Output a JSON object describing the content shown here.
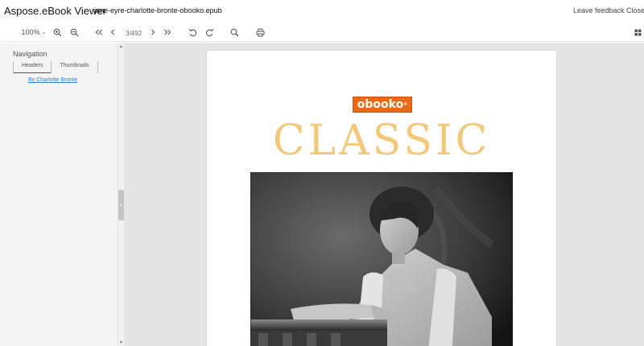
{
  "header": {
    "app_title": "Aspose.eBook Viewer",
    "file_name": "jane-eyre-charlotte-bronte-obooko.epub",
    "leave_feedback": "Leave feedback",
    "close": "Close"
  },
  "toolbar": {
    "zoom_value": "100%",
    "page_indicator": "3/492",
    "icons": [
      "zoom-in-icon",
      "zoom-out-icon",
      "first-page-icon",
      "previous-page-icon",
      "next-page-icon",
      "last-page-icon",
      "rotate-left-icon",
      "rotate-right-icon",
      "search-icon",
      "print-icon",
      "grid-view-icon"
    ]
  },
  "sidebar": {
    "title": "Navigation",
    "tabs": [
      {
        "label": "Headers",
        "active": true
      },
      {
        "label": "Thumbnails",
        "active": false
      }
    ],
    "toc": [
      {
        "label": "By Charlotte Bronte"
      }
    ]
  },
  "document": {
    "logo_text": "obooko",
    "logo_mark": "®",
    "heading": "CLASSIC",
    "colors": {
      "logo_bg": "#e86a16",
      "heading": "#f2c97a",
      "link": "#2f7fd6"
    }
  }
}
